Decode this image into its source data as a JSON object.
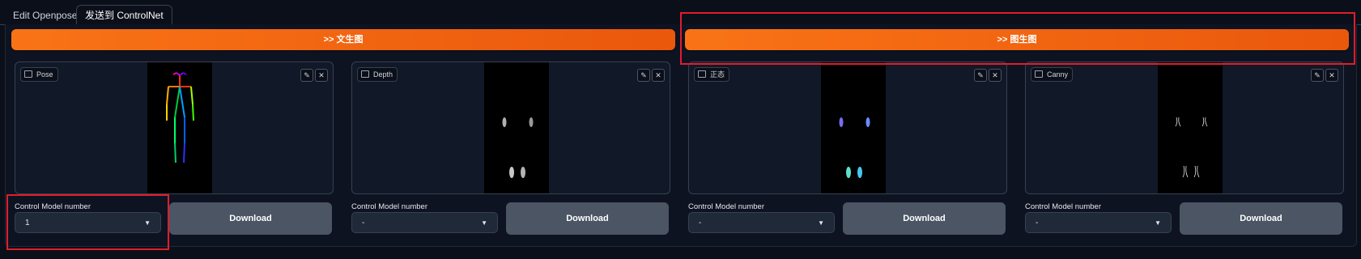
{
  "tabs": [
    {
      "label": "Edit Openpose",
      "active": false
    },
    {
      "label": "发送到 ControlNet",
      "active": true
    }
  ],
  "buttons": {
    "txt2img": ">> 文生图",
    "img2img": ">> 图生图"
  },
  "cards": [
    {
      "label": "Pose",
      "control_label": "Control Model number",
      "select_value": "1",
      "download_label": "Download"
    },
    {
      "label": "Depth",
      "control_label": "Control Model number",
      "select_value": "-",
      "download_label": "Download"
    },
    {
      "label": "正态",
      "control_label": "Control Model number",
      "select_value": "-",
      "download_label": "Download"
    },
    {
      "label": "Canny",
      "control_label": "Control Model number",
      "select_value": "-",
      "download_label": "Download"
    }
  ],
  "icons": {
    "edit": "pencil-icon",
    "close": "close-icon",
    "image_label": "image-icon",
    "dropdown": "chevron-down-icon"
  },
  "colors": {
    "accent": "#f97316",
    "highlight": "#e11d2b",
    "background": "#0b0f19"
  }
}
